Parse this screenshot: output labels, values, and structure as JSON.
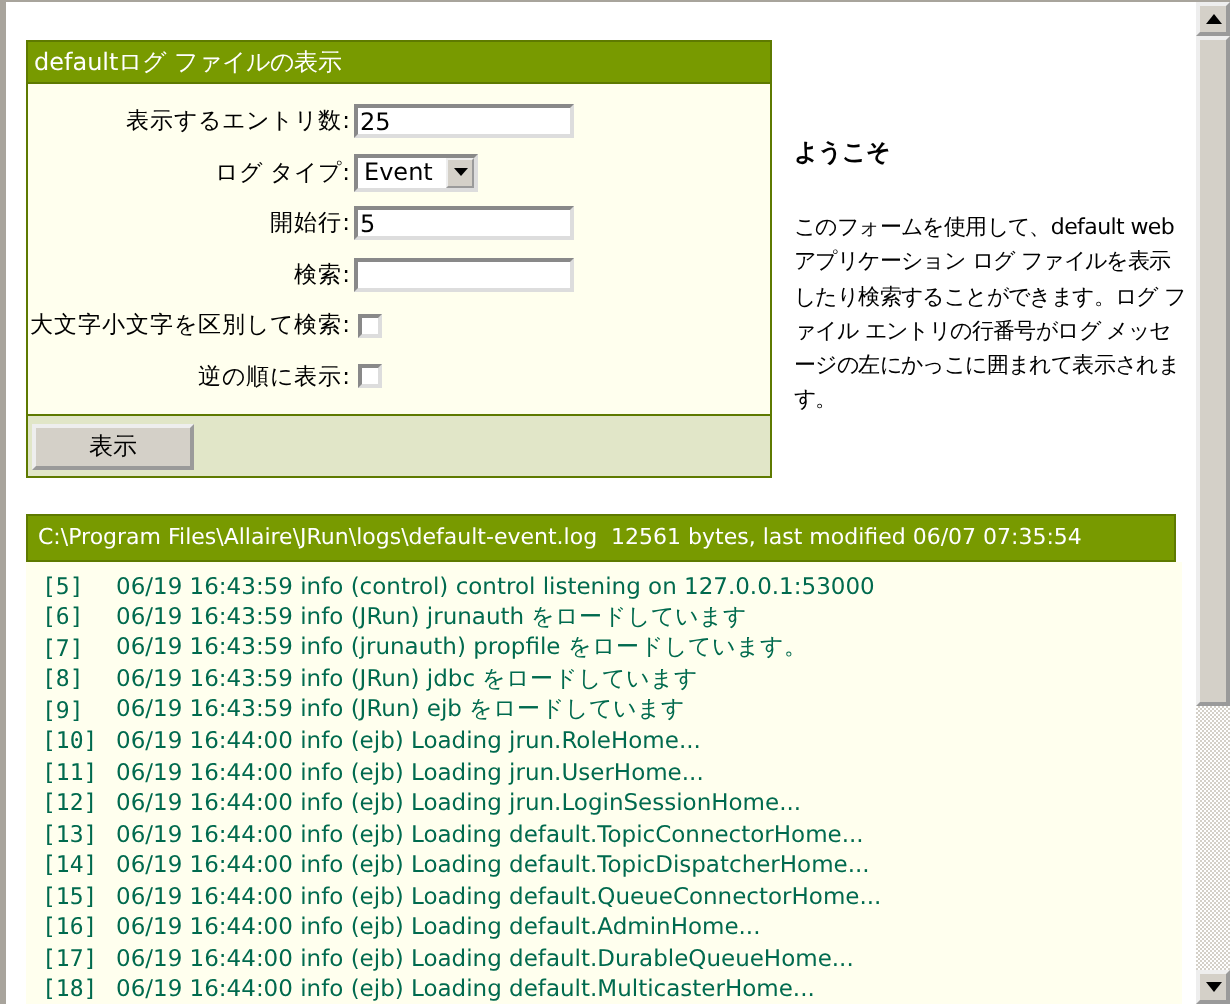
{
  "form_panel": {
    "title": "defaultログ ファイルの表示",
    "fields": [
      {
        "kind": "text",
        "label": "表示するエントリ数:",
        "value": "25"
      },
      {
        "kind": "select",
        "label": "ログ タイプ:",
        "value": "Event"
      },
      {
        "kind": "text",
        "label": "開始行:",
        "value": "5"
      },
      {
        "kind": "text",
        "label": "検索:"
      },
      {
        "kind": "checkbox",
        "label": "大文字小文字を区別して検索:",
        "checked": false
      },
      {
        "kind": "checkbox",
        "label": "逆の順に表示:",
        "checked": false
      }
    ],
    "submit_button": "表示"
  },
  "welcome": {
    "heading": "ようこそ",
    "text": "このフォームを使用して、default web アプリケーション ログ ファイルを表示したり検索することができます。ログ ファイル エントリの行番号がログ メッセージの左にかっこに囲まれて表示されます。"
  },
  "log": {
    "header": "C:\\Program Files\\Allaire\\JRun\\logs\\default-event.log  12561 bytes, last modified 06/07 07:35:54",
    "entries": [
      {
        "number": "[5]",
        "message": "06/19 16:43:59 info (control) control listening on 127.0.0.1:53000"
      },
      {
        "number": "[6]",
        "message": "06/19 16:43:59 info (JRun) jrunauth をロードしています"
      },
      {
        "number": "[7]",
        "message": "06/19 16:43:59 info (jrunauth) propfile をロードしています。"
      },
      {
        "number": "[8]",
        "message": "06/19 16:43:59 info (JRun) jdbc をロードしています"
      },
      {
        "number": "[9]",
        "message": "06/19 16:43:59 info (JRun) ejb をロードしています"
      },
      {
        "number": "[10]",
        "message": "06/19 16:44:00 info (ejb) Loading jrun.RoleHome..."
      },
      {
        "number": "[11]",
        "message": "06/19 16:44:00 info (ejb) Loading jrun.UserHome..."
      },
      {
        "number": "[12]",
        "message": "06/19 16:44:00 info (ejb) Loading jrun.LoginSessionHome..."
      },
      {
        "number": "[13]",
        "message": "06/19 16:44:00 info (ejb) Loading default.TopicConnectorHome..."
      },
      {
        "number": "[14]",
        "message": "06/19 16:44:00 info (ejb) Loading default.TopicDispatcherHome..."
      },
      {
        "number": "[15]",
        "message": "06/19 16:44:00 info (ejb) Loading default.QueueConnectorHome..."
      },
      {
        "number": "[16]",
        "message": "06/19 16:44:00 info (ejb) Loading default.AdminHome..."
      },
      {
        "number": "[17]",
        "message": "06/19 16:44:00 info (ejb) Loading default.DurableQueueHome..."
      },
      {
        "number": "[18]",
        "message": "06/19 16:44:00 info (ejb) Loading default.MulticasterHome..."
      }
    ]
  }
}
